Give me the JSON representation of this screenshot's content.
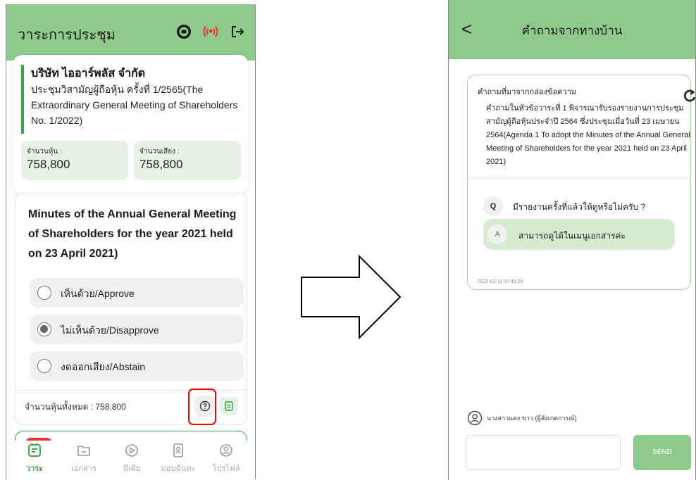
{
  "left_screen": {
    "header": {
      "title": "วาระการประชุม"
    },
    "company_name": "บริษัท ไออาร์พลัส จำกัด",
    "meeting_title": "ประชุมวิสามัญผู้ถือหุ้น ครั้งที่ 1/2565(The Extraordinary General Meeting of Shareholders No. 1/2022)",
    "shares": {
      "label": "จำนวนหุ้น :",
      "value": "758,800"
    },
    "votes": {
      "label": "จำนวนเสียง :",
      "value": "758,800"
    },
    "agenda_text": "Minutes of the Annual General Meeting of Shareholders for the year 2021 held on 23 April 2021)",
    "options": [
      {
        "label": "เห็นด้วย/Approve",
        "selected": false
      },
      {
        "label": "ไม่เห็นด้วย/Disapprove",
        "selected": true
      },
      {
        "label": "งดออกเสียง/Abstain",
        "selected": false
      }
    ],
    "total_shares": "จำนวนหุ้นทั้งหมด : 758,800",
    "nav": [
      {
        "label": "วาระ",
        "icon": "agenda-icon",
        "active": true
      },
      {
        "label": "เอกสาร",
        "icon": "folder-icon",
        "active": false
      },
      {
        "label": "มีเดีย",
        "icon": "play-icon",
        "active": false
      },
      {
        "label": "มอบฉันทะ",
        "icon": "proxy-icon",
        "active": false
      },
      {
        "label": "โปรไฟล์",
        "icon": "profile-icon",
        "active": false
      }
    ],
    "accent_color": "#8fc98b",
    "highlight_color": "#e00000"
  },
  "right_screen": {
    "header": {
      "title": "คำถามจากทางบ้าน"
    },
    "source_label": "คำถามที่มาจากกล่องข้อความ",
    "question_topic": "คำถามในหัวข้อวาระที่ 1 พิจารณารับรองรายงานการประชุมสามัญผู้ถือหุ้นประจำปี 2564 ซึ่งประชุมเมื่อวันที่ 23 เมษายน 2564(Agenda 1 To adopt the Minutes of the Annual General Meeting of Shareholders for the year 2021 held on 23 April 2021)",
    "q_badge": "Q",
    "question": "มีรายงานครั้งที่แล้วให้ดูหรือไม่ครับ ?",
    "a_badge": "A",
    "answer": "สามารถดูได้ในเมนูเอกสารค่ะ",
    "timestamp": "2022-02-11 17:42:28",
    "user_name": "นางสาวแดง ขาว (ผู้สังเกตการณ์)",
    "send_label": "SEND"
  }
}
